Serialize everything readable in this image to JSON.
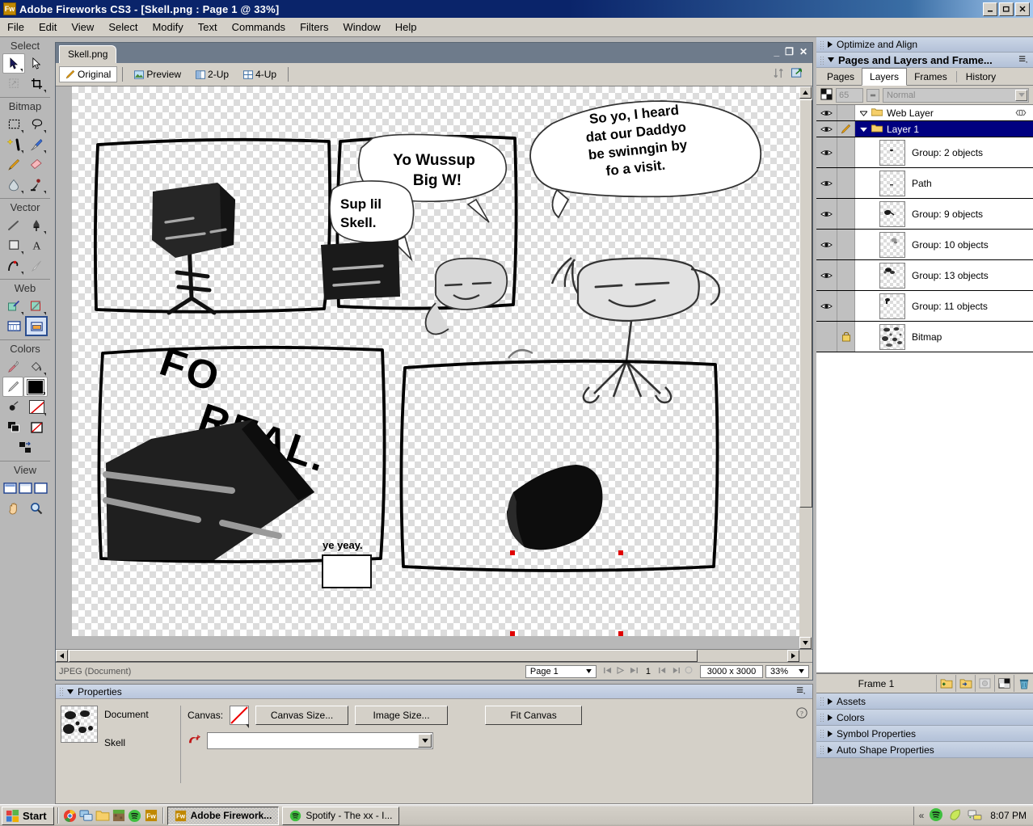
{
  "window": {
    "app_icon": "fireworks-app-icon",
    "title": "Adobe Fireworks CS3 - [Skell.png : Page 1 @  33%]",
    "minimize": "_",
    "restore": "❐",
    "close": "✕"
  },
  "menu": {
    "items": [
      "File",
      "Edit",
      "View",
      "Select",
      "Modify",
      "Text",
      "Commands",
      "Filters",
      "Window",
      "Help"
    ]
  },
  "toolbox": {
    "sections": [
      {
        "title": "Select",
        "tools": [
          "pointer-tool",
          "subselection-tool",
          "scale-tool",
          "crop-tool"
        ]
      },
      {
        "title": "Bitmap",
        "tools": [
          "marquee-tool",
          "lasso-tool",
          "magic-wand-tool",
          "brush-tool",
          "pencil-tool",
          "eraser-tool",
          "blur-tool",
          "rubber-stamp-tool"
        ]
      },
      {
        "title": "Vector",
        "tools": [
          "line-tool",
          "pen-tool",
          "rectangle-tool",
          "text-tool",
          "freeform-tool",
          "knife-tool"
        ]
      },
      {
        "title": "Web",
        "tools": [
          "slice-tool",
          "polygon-slice-tool",
          "hide-slices-tool",
          "show-slices-tool"
        ]
      },
      {
        "title": "Colors",
        "tools": [
          "eyedropper-tool",
          "paint-bucket-tool",
          "stroke-color-swatch",
          "fill-color-swatch",
          "no-stroke-tool",
          "no-fill-swatch",
          "default-colors",
          "no-color",
          "swap-colors"
        ]
      },
      {
        "title": "View",
        "tools": [
          "standard-screen-mode",
          "full-screen-menu-mode",
          "full-screen-mode",
          "hand-tool",
          "zoom-tool"
        ]
      }
    ]
  },
  "document": {
    "tab_label": "Skell.png",
    "view_tabs": [
      {
        "label": "Original",
        "icon": "pencil-icon",
        "active": true
      },
      {
        "label": "Preview",
        "icon": "image-icon",
        "active": false
      },
      {
        "label": "2-Up",
        "icon": "two-up-icon",
        "active": false
      },
      {
        "label": "4-Up",
        "icon": "four-up-icon",
        "active": false
      }
    ],
    "win_minimize": "_",
    "win_restore": "❐",
    "win_close": "✕"
  },
  "statusbar": {
    "doc_info": "JPEG (Document)",
    "page_select": "Page 1",
    "frame_number": "1",
    "dimensions": "3000 x 3000",
    "zoom": "33%"
  },
  "properties": {
    "panel_title": "Properties",
    "object_type": "Document",
    "object_name": "Skell",
    "canvas_label": "Canvas:",
    "canvas_size_button": "Canvas Size...",
    "image_size_button": "Image Size...",
    "fit_canvas_button": "Fit Canvas",
    "matte_value": "",
    "help_icon": "help-icon"
  },
  "rightdock": {
    "optimize_panel": "Optimize and Align",
    "pages_panel": "Pages and Layers and Frame...",
    "tabs": [
      {
        "label": "Pages",
        "active": false
      },
      {
        "label": "Layers",
        "active": true
      },
      {
        "label": "Frames",
        "active": false
      },
      {
        "label": "History",
        "active": false
      }
    ],
    "opacity": "65",
    "blend_mode": "Normal",
    "layers": [
      {
        "name": "Web Layer",
        "type": "folder",
        "selected": false,
        "expanded": true,
        "eye": true,
        "pen": false,
        "thumb": false
      },
      {
        "name": "Layer 1",
        "type": "folder",
        "selected": true,
        "expanded": true,
        "eye": true,
        "pen": true,
        "thumb": false
      },
      {
        "name": "Group: 2 objects",
        "type": "object",
        "selected": false,
        "eye": true,
        "pen": false,
        "thumb": true
      },
      {
        "name": "Path",
        "type": "object",
        "selected": false,
        "eye": true,
        "pen": false,
        "thumb": true
      },
      {
        "name": "Group: 9 objects",
        "type": "object",
        "selected": false,
        "eye": true,
        "pen": false,
        "thumb": true
      },
      {
        "name": "Group: 10 objects",
        "type": "object",
        "selected": false,
        "eye": true,
        "pen": false,
        "thumb": true
      },
      {
        "name": "Group: 13 objects",
        "type": "object",
        "selected": false,
        "eye": true,
        "pen": false,
        "thumb": true
      },
      {
        "name": "Group: 11 objects",
        "type": "object",
        "selected": false,
        "eye": true,
        "pen": false,
        "thumb": true
      },
      {
        "name": "Bitmap",
        "type": "object",
        "selected": false,
        "eye": false,
        "pen": false,
        "lock": true,
        "thumb": true
      }
    ],
    "frame_label": "Frame 1",
    "frame_buttons": [
      "new-layer-icon",
      "new-sublayer-icon",
      "add-mask-icon",
      "add-bitmap-mask-icon",
      "delete-icon"
    ],
    "collapsed_panels": [
      "Assets",
      "Colors",
      "Symbol Properties",
      "Auto Shape Properties"
    ]
  },
  "canvas_art": {
    "panel2_bubble1": [
      "Yo Wussup",
      "Big W!"
    ],
    "panel2_bubble2": [
      "Sup lil",
      "Skell."
    ],
    "panel3_bubble": [
      "So yo, I heard",
      "dat our Daddyo",
      "be swinngin by",
      "fo a visit."
    ],
    "panel4_text": [
      "FO",
      "REAL."
    ],
    "panel4_small_text": "ye yeay.",
    "selection_handle_color": "#e00000"
  },
  "taskbar": {
    "start_label": "Start",
    "quicklaunch": [
      "chrome-icon",
      "network-icon",
      "folder-icon",
      "minecraft-icon",
      "spotify-icon",
      "fireworks-icon"
    ],
    "tasks": [
      {
        "label": "Adobe Firework...",
        "icon": "fireworks-icon",
        "active": true
      },
      {
        "label": "Spotify - The xx - I...",
        "icon": "spotify-icon",
        "active": false
      }
    ],
    "tray_expand": "«",
    "tray_icons": [
      "spotify-tray-icon",
      "green-leaf-tray-icon",
      "network-tray-icon"
    ],
    "clock": "8:07 PM"
  }
}
